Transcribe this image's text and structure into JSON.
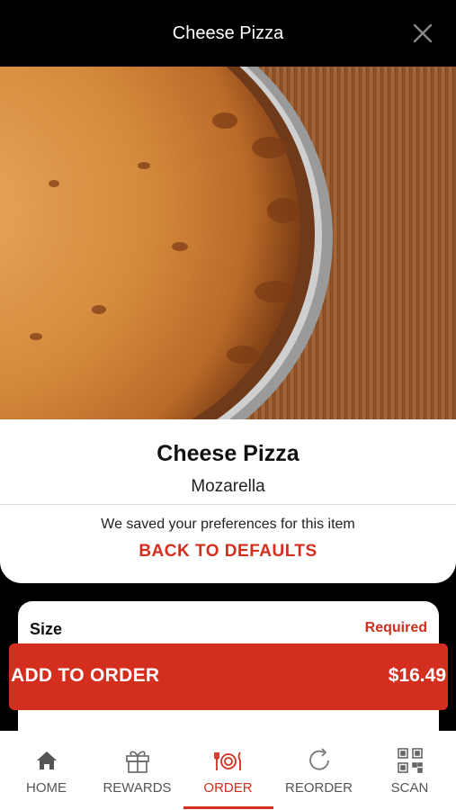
{
  "header": {
    "title": "Cheese Pizza",
    "close_icon": "close-icon"
  },
  "item": {
    "name": "Cheese Pizza",
    "description": "Mozarella"
  },
  "preferences": {
    "note": "We saved your preferences for this item",
    "reset_label": "BACK TO DEFAULTS"
  },
  "options": {
    "label": "Size",
    "required_label": "Required"
  },
  "cart": {
    "add_label": "ADD TO ORDER",
    "price": "$16.49"
  },
  "tabs": [
    {
      "label": "HOME",
      "icon": "home-icon",
      "active": false
    },
    {
      "label": "REWARDS",
      "icon": "gift-icon",
      "active": false
    },
    {
      "label": "ORDER",
      "icon": "plate-utensils-icon",
      "active": true
    },
    {
      "label": "REORDER",
      "icon": "refresh-icon",
      "active": false
    },
    {
      "label": "SCAN",
      "icon": "qr-code-icon",
      "active": false
    }
  ],
  "colors": {
    "accent": "#d42e1f",
    "header_bg": "#000000",
    "inactive_tab": "#555555"
  }
}
